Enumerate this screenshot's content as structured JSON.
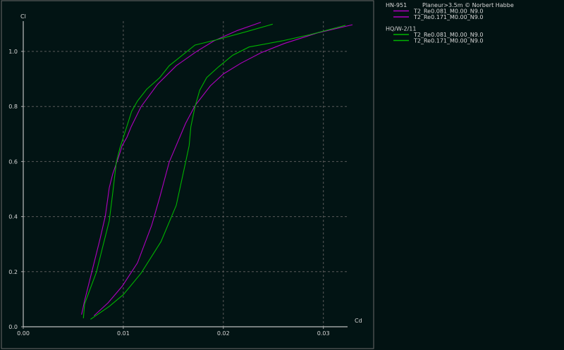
{
  "chart_data": {
    "type": "line",
    "title": "",
    "xlabel": "Cd",
    "ylabel": "Cl",
    "xlim": [
      0,
      0.0325
    ],
    "ylim": [
      0,
      1.1
    ],
    "xticks": [
      "0.00",
      "0.01",
      "0.02",
      "0.03"
    ],
    "xtick_values": [
      0,
      0.01,
      0.02,
      0.03
    ],
    "yticks": [
      "0.0",
      "0.2",
      "0.4",
      "0.6",
      "0.8",
      "1.0"
    ],
    "ytick_values": [
      0,
      0.2,
      0.4,
      0.6,
      0.8,
      1.0
    ],
    "grid": true,
    "legend_placement": "right-panel",
    "legend_groups": [
      {
        "title": "HN-951",
        "subtitle": "Planeur>3.5m © Norbert Habbe",
        "series_idx": [
          0,
          1
        ]
      },
      {
        "title": "HQ/W-2/11",
        "subtitle": "",
        "series_idx": [
          2,
          3
        ]
      }
    ],
    "series": [
      {
        "name": "T2_Re0.081_M0.00_N9.0",
        "color": "#b000c0",
        "x": [
          0.00707,
          0.00848,
          0.00989,
          0.01142,
          0.01283,
          0.01365,
          0.01459,
          0.01564,
          0.01623,
          0.01717,
          0.0187,
          0.01999,
          0.02175,
          0.02375,
          0.0261,
          0.02939,
          0.03291
        ],
        "y": [
          0.04,
          0.087,
          0.147,
          0.232,
          0.368,
          0.471,
          0.598,
          0.688,
          0.739,
          0.803,
          0.875,
          0.918,
          0.957,
          0.995,
          1.029,
          1.067,
          1.097
        ]
      },
      {
        "name": "T2_Re0.171_M0.00_N9.0",
        "color": "#b000c0",
        "x": [
          0.00583,
          0.00613,
          0.00684,
          0.00766,
          0.0082,
          0.0086,
          0.00895,
          0.00953,
          0.00989,
          0.01036,
          0.01078,
          0.01177,
          0.01341,
          0.01529,
          0.01729,
          0.01905,
          0.0214,
          0.02375
        ],
        "y": [
          0.044,
          0.095,
          0.198,
          0.317,
          0.402,
          0.505,
          0.556,
          0.616,
          0.658,
          0.688,
          0.726,
          0.799,
          0.88,
          0.948,
          0.999,
          1.038,
          1.076,
          1.106
        ]
      },
      {
        "name": "T2_Re0.081_M0.00_N9.0",
        "color": "#00b400",
        "x": [
          0.00672,
          0.0086,
          0.01001,
          0.01177,
          0.01376,
          0.01529,
          0.01623,
          0.01658,
          0.01675,
          0.01717,
          0.01764,
          0.01834,
          0.01952,
          0.02093,
          0.02257,
          0.02586,
          0.02868,
          0.03221
        ],
        "y": [
          0.027,
          0.074,
          0.117,
          0.194,
          0.309,
          0.441,
          0.598,
          0.658,
          0.726,
          0.799,
          0.859,
          0.905,
          0.944,
          0.986,
          1.016,
          1.038,
          1.061,
          1.095
        ]
      },
      {
        "name": "T2_Re0.171_M0.00_N9.0",
        "color": "#00b400",
        "x": [
          0.00601,
          0.00613,
          0.00731,
          0.00789,
          0.0086,
          0.00895,
          0.0093,
          0.00966,
          0.01001,
          0.01083,
          0.01142,
          0.01235,
          0.01365,
          0.01459,
          0.01717,
          0.01929,
          0.02234,
          0.02493
        ],
        "y": [
          0.031,
          0.083,
          0.198,
          0.283,
          0.385,
          0.488,
          0.598,
          0.649,
          0.688,
          0.782,
          0.82,
          0.863,
          0.905,
          0.948,
          1.023,
          1.042,
          1.072,
          1.099
        ]
      }
    ]
  }
}
